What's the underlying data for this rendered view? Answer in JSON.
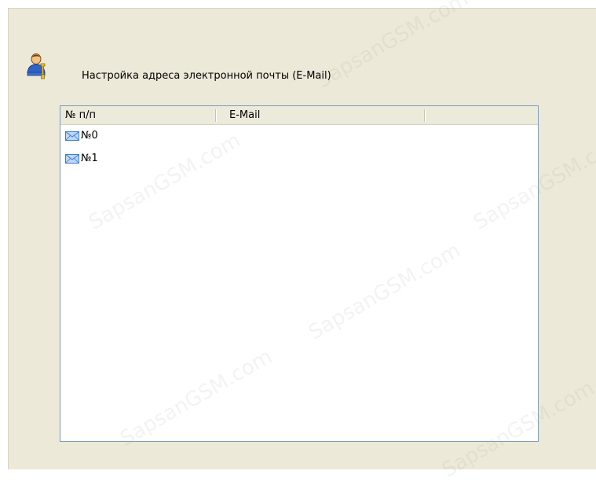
{
  "section": {
    "icon": "user-settings-icon",
    "title": "Настройка адреса электронной почты (E-Mail)"
  },
  "table": {
    "columns": [
      "№ п/п",
      "E-Mail",
      ""
    ],
    "rows": [
      {
        "icon": "envelope-icon",
        "number": "№0",
        "email": ""
      },
      {
        "icon": "envelope-icon",
        "number": "№1",
        "email": ""
      }
    ]
  },
  "watermark": {
    "text": "SapsanGSM.com"
  },
  "colors": {
    "panel_background": "#ece9d8",
    "table_border": "#7f9db9",
    "header_background": "#ebeadb"
  }
}
